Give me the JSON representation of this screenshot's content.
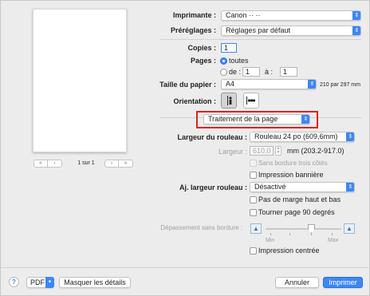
{
  "printer": {
    "label": "Imprimante :",
    "value": "Canon ·· ··"
  },
  "presets": {
    "label": "Préréglages :",
    "value": "Réglages par défaut"
  },
  "copies": {
    "label": "Copies :",
    "value": "1"
  },
  "pages": {
    "label": "Pages :",
    "all": "toutes",
    "from_label": "de :",
    "from": "1",
    "to_label": "à :",
    "to": "1"
  },
  "paper": {
    "label": "Taille du papier :",
    "value": "A4",
    "dims": "210 par 297 mm"
  },
  "orientation": {
    "label": "Orientation :"
  },
  "section": {
    "value": "Traitement de la page",
    "highlight_color": "#e0211a"
  },
  "roll_width": {
    "label": "Largeur du rouleau :",
    "value": "Rouleau 24 po (609,6mm)"
  },
  "width": {
    "label": "Largeur :",
    "value": "610.0",
    "unit": "mm (203.2-917.0)"
  },
  "borderless_three": {
    "label": "Sans bordure trois côtés"
  },
  "banner": {
    "label": "Impression bannière"
  },
  "fit_roll": {
    "label": "Aj. largeur rouleau :",
    "value": "Désactivé"
  },
  "no_margin": {
    "label": "Pas de marge haut et bas"
  },
  "rotate": {
    "label": "Tourner page 90 degrés"
  },
  "overflow": {
    "label": "Dépassement sans bordure :",
    "min": "Min",
    "max": "Max"
  },
  "centered": {
    "label": "Impression centrée"
  },
  "preview": {
    "page_text": "1 sur 1",
    "first": "«",
    "prev": "‹",
    "next": "›",
    "last": "»"
  },
  "footer": {
    "help": "?",
    "pdf": "PDF",
    "details": "Masquer les détails",
    "cancel": "Annuler",
    "print": "Imprimer"
  },
  "icons": {
    "popup_arrow": "⇕",
    "portrait": "portrait-icon",
    "landscape": "landscape-icon"
  },
  "colors": {
    "accent": "#3d87f5"
  }
}
